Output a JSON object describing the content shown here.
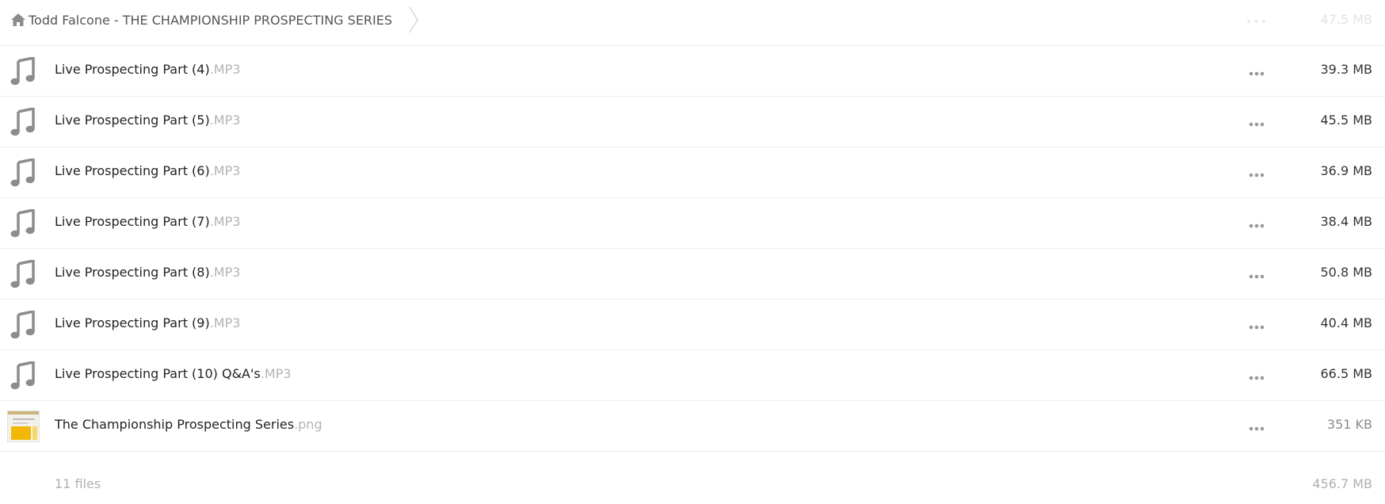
{
  "breadcrumb": {
    "home_icon": "home-icon",
    "folder_title": "Todd Falcone - THE CHAMPIONSHIP PROSPECTING SERIES"
  },
  "scrolled_row": {
    "size": "47.5 MB"
  },
  "files": [
    {
      "name": "Live Prospecting Part (4)",
      "ext": ".MP3",
      "size": "39.3 MB",
      "icon": "music-note-icon"
    },
    {
      "name": "Live Prospecting Part (5)",
      "ext": ".MP3",
      "size": "45.5 MB",
      "icon": "music-note-icon"
    },
    {
      "name": "Live Prospecting Part (6)",
      "ext": ".MP3",
      "size": "36.9 MB",
      "icon": "music-note-icon"
    },
    {
      "name": "Live Prospecting Part (7)",
      "ext": ".MP3",
      "size": "38.4 MB",
      "icon": "music-note-icon"
    },
    {
      "name": "Live Prospecting Part (8)",
      "ext": ".MP3",
      "size": "50.8 MB",
      "icon": "music-note-icon"
    },
    {
      "name": "Live Prospecting Part (9)",
      "ext": ".MP3",
      "size": "40.4 MB",
      "icon": "music-note-icon"
    },
    {
      "name": "Live Prospecting Part (10) Q&A's",
      "ext": ".MP3",
      "size": "66.5 MB",
      "icon": "music-note-icon"
    },
    {
      "name": "The Championship Prospecting Series",
      "ext": ".png",
      "size": "351 KB",
      "icon": "image-thumbnail"
    }
  ],
  "footer": {
    "file_count": "11 files",
    "total_size": "456.7 MB"
  },
  "colors": {
    "icon_gray": "#8c8c8c",
    "divider": "#ececec",
    "ext_gray": "#b3b3b3",
    "footer_gray": "#b0b0b0"
  }
}
